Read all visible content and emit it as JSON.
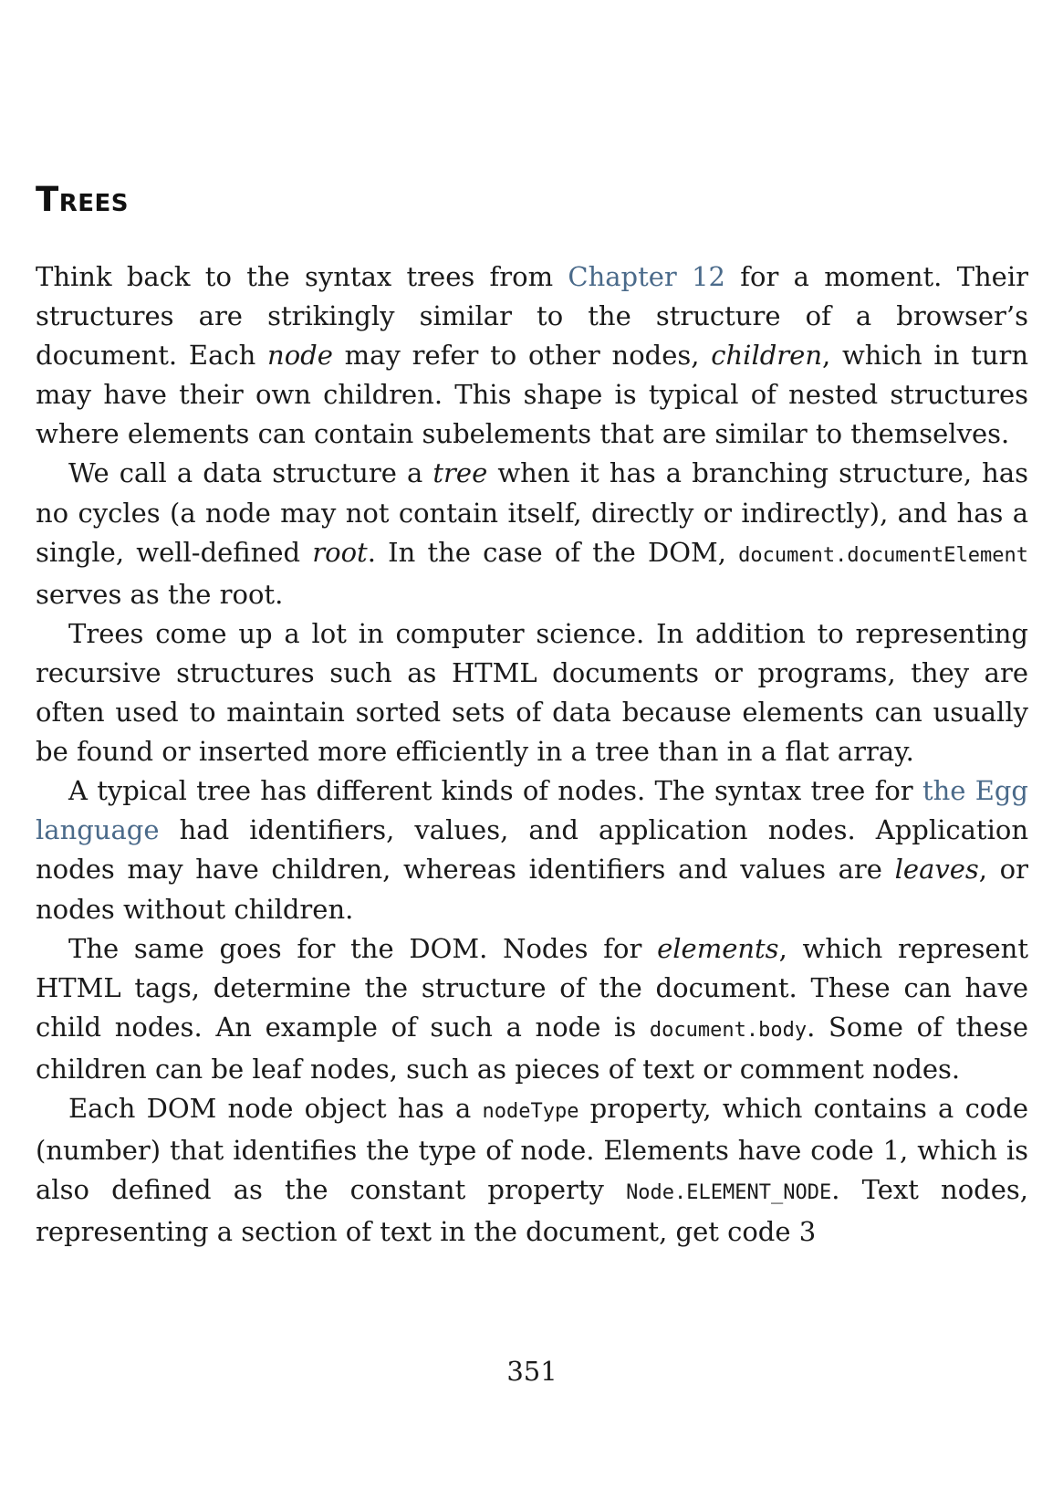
{
  "section": {
    "title": "Trees"
  },
  "paragraphs": [
    {
      "s1": "Think back to the syntax trees from ",
      "link": "Chapter 12",
      "s2": " for a moment. Their structures are strikingly similar to the structure of a browser’s document. Each ",
      "em1": "node",
      "s3": " may refer to other nodes, ",
      "em2": "children",
      "s4": ", which in turn may have their own children. This shape is typical of nested structures where elements can contain subelements that are similar to themselves."
    },
    {
      "s1": "We call a data structure a ",
      "em1": "tree",
      "s2": " when it has a branching structure, has no cycles (a node may not contain itself, directly or indirectly), and has a single, well-defined ",
      "em2": "root",
      "s3": ". In the case of the DOM, ",
      "code1": "document.documentElement",
      "s4": " serves as the root."
    },
    {
      "text": "Trees come up a lot in computer science. In addition to representing recursive structures such as HTML documents or programs, they are often used to maintain sorted sets of data because elements can usually be found or inserted more efficiently in a tree than in a flat array."
    },
    {
      "s1": "A typical tree has different kinds of nodes. The syntax tree for ",
      "link": "the Egg language",
      "s2": " had identifiers, values, and application nodes. Application nodes may have children, whereas identifiers and values are ",
      "em1": "leaves",
      "s3": ", or nodes without children."
    },
    {
      "s1": "The same goes for the DOM. Nodes for ",
      "em1": "elements",
      "s2": ", which represent HTML tags, determine the structure of the document. These can have child nodes. An example of such a node is ",
      "code1": "document.body",
      "s3": ". Some of these children can be leaf nodes, such as pieces of text or comment nodes."
    },
    {
      "s1": "Each DOM node object has a ",
      "code1": "nodeType",
      "s2": " property, which contains a code (number) that identifies the type of node. Elements have code 1, which is also defined as the constant property ",
      "code2": "Node.ELEMENT_NODE",
      "s3": ". Text nodes, representing a section of text in the document, get code 3"
    }
  ],
  "footer": {
    "page_number": "351"
  },
  "colors": {
    "text": "#1a1a1a",
    "link": "#4a6a8a",
    "background": "#ffffff"
  }
}
